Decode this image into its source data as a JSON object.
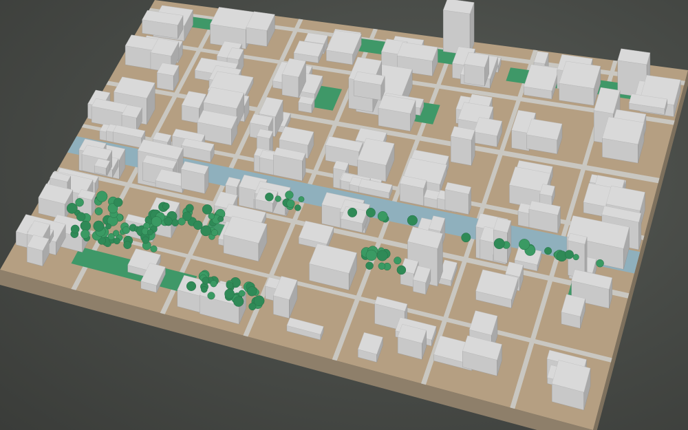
{
  "scene": {
    "kind": "3d-city-block-model",
    "colors": {
      "background": "#4a4d49",
      "ground": "#b59f82",
      "base_side": "#8e7f6a",
      "road": "#c9c7c1",
      "building_top": "#d9d9d9",
      "building_left": "#c8c8c8",
      "building_right": "#a9a9a9",
      "water": "#8fb0bd",
      "green": "#3f9868",
      "tree": "#2f8a57"
    }
  }
}
